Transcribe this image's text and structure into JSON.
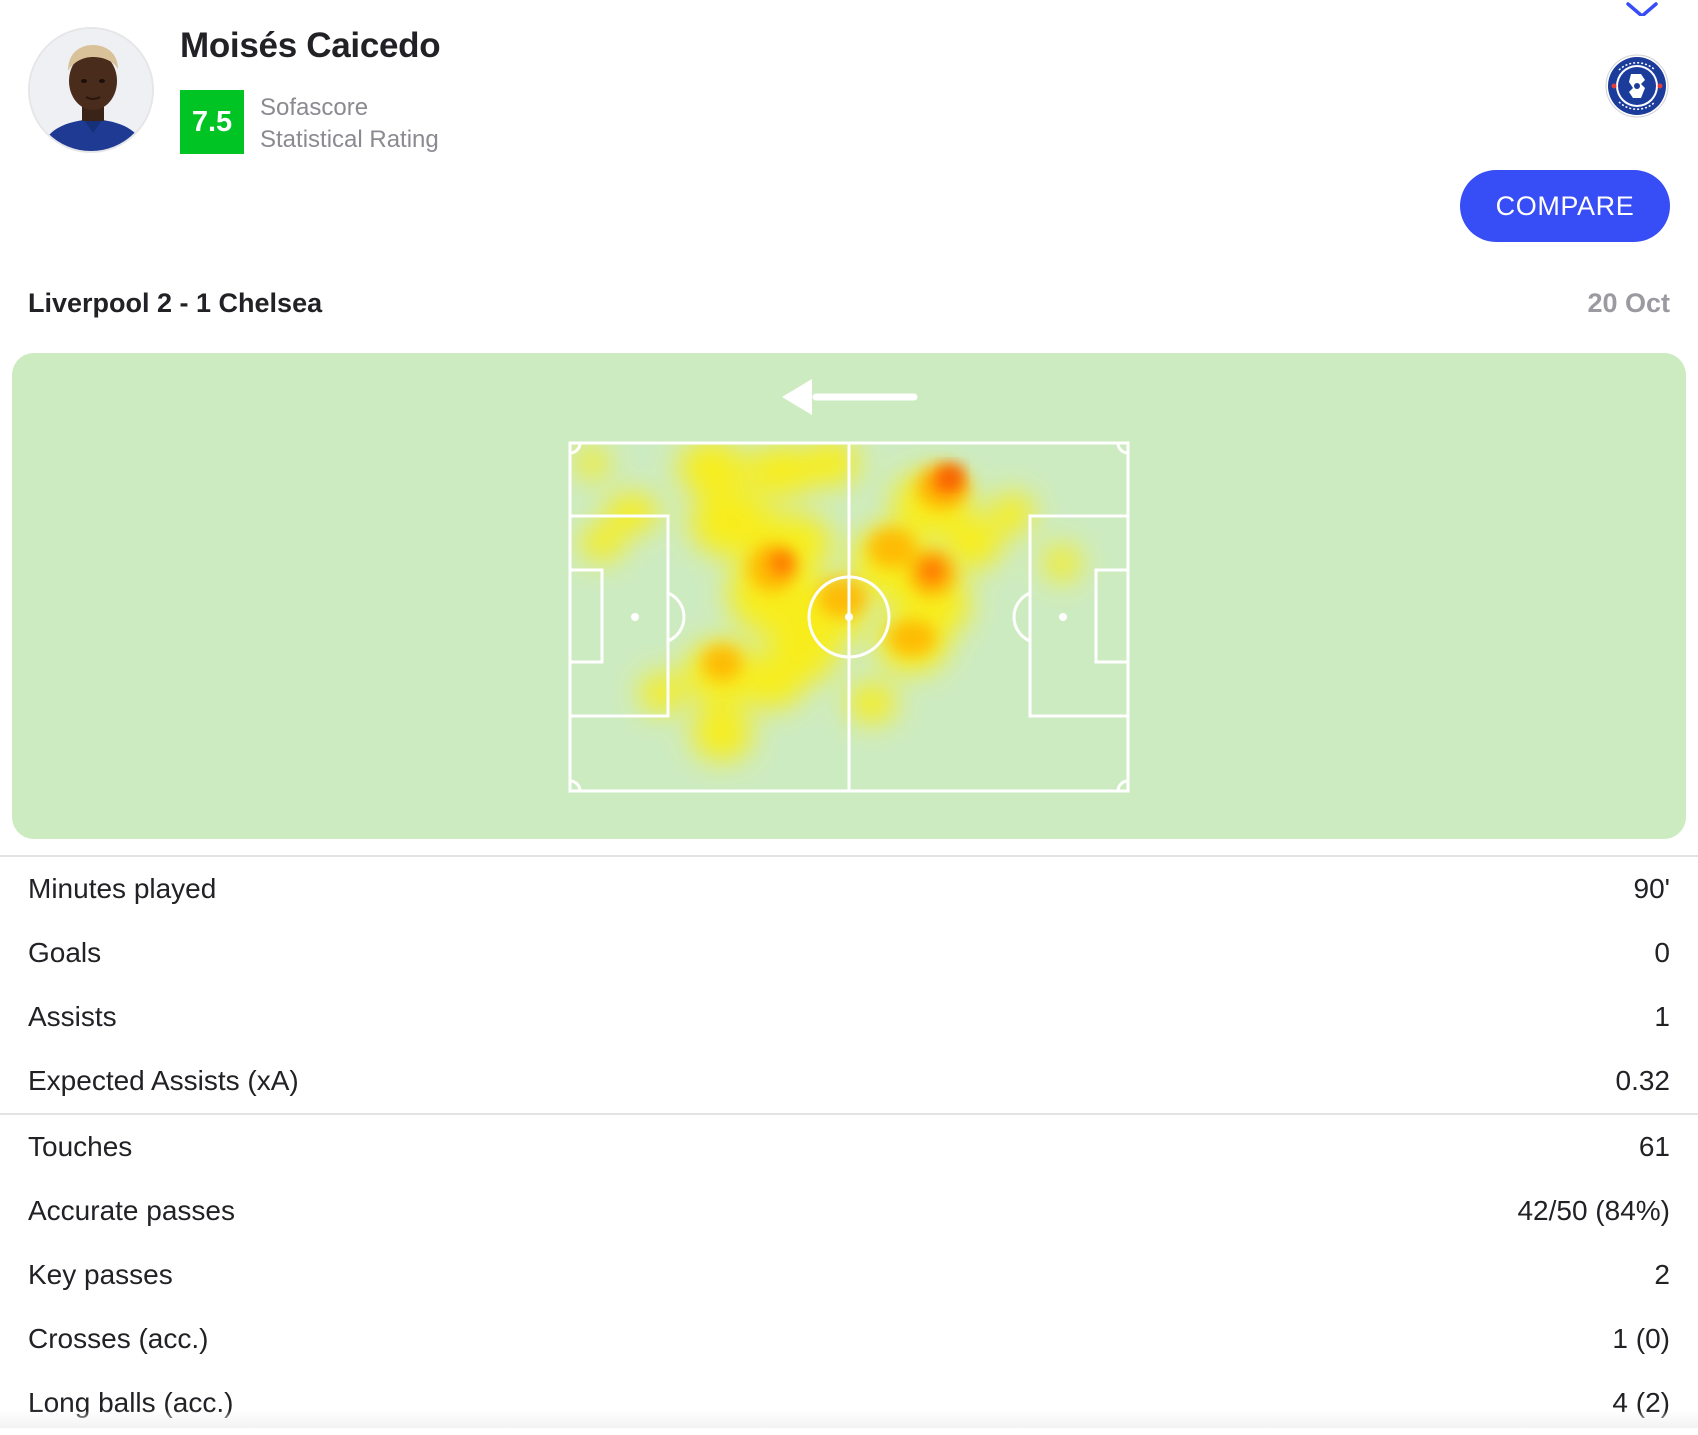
{
  "header": {
    "player_name": "Moisés Caicedo",
    "rating": "7.5",
    "rating_label_line1": "Sofascore",
    "rating_label_line2": "Statistical Rating",
    "rating_color": "#00c424",
    "club_badge_icon": "chelsea-crest-icon",
    "close_icon": "chevron-up-icon",
    "compare_label": "COMPARE",
    "accent_color": "#374df5"
  },
  "match": {
    "title": "Liverpool 2 - 1 Chelsea",
    "date": "20 Oct"
  },
  "heatmap": {
    "direction_icon": "arrow-left-icon",
    "pitch_color": "#cdebc0"
  },
  "stats_group1": [
    {
      "label": "Minutes played",
      "value": "90'"
    },
    {
      "label": "Goals",
      "value": "0"
    },
    {
      "label": "Assists",
      "value": "1"
    },
    {
      "label": "Expected Assists (xA)",
      "value": "0.32"
    }
  ],
  "stats_group2": [
    {
      "label": "Touches",
      "value": "61"
    },
    {
      "label": "Accurate passes",
      "value": "42/50 (84%)"
    },
    {
      "label": "Key passes",
      "value": "2"
    },
    {
      "label": "Crosses (acc.)",
      "value": "1 (0)"
    },
    {
      "label": "Long balls (acc.)",
      "value": "4 (2)"
    }
  ]
}
